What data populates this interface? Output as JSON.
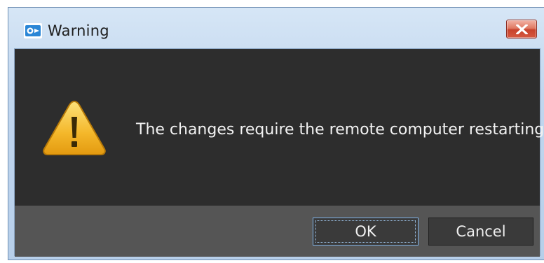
{
  "window": {
    "title": "Warning",
    "app_icon": "remote-desktop-app-icon",
    "close_icon": "close-icon"
  },
  "dialog": {
    "icon": "warning-triangle-icon",
    "message": "The changes require the remote computer restarting"
  },
  "buttons": {
    "ok_label": "OK",
    "cancel_label": "Cancel"
  },
  "colors": {
    "content_bg": "#2d2d2d",
    "footer_bg": "#555555",
    "titlebar_bg": "#c1d6ee",
    "close_button": "#c8432c",
    "warning_icon": "#f2b01e",
    "focus_border": "#7fb3e8"
  }
}
